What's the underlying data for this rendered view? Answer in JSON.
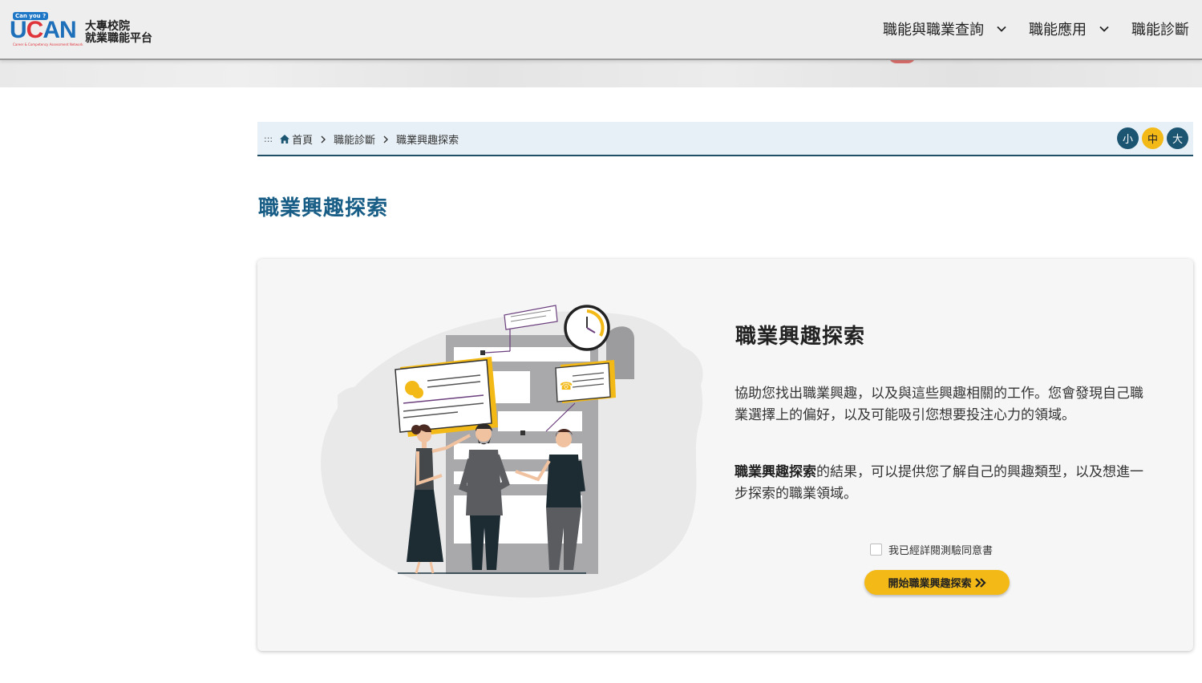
{
  "header": {
    "logo": {
      "badge": "Can you ?",
      "brand_u": "U",
      "brand_c": "C",
      "brand_an": "AN",
      "tagline": "Career & Competency Assessment Network",
      "name_line1": "大專校院",
      "name_line2": "就業職能平台"
    },
    "nav": [
      {
        "label": "職能與職業查詢",
        "has_dropdown": true,
        "icon": "chevron-down-icon"
      },
      {
        "label": "職能應用",
        "has_dropdown": true,
        "icon": "chevron-down-icon"
      },
      {
        "label": "職能診斷",
        "has_dropdown": false
      }
    ]
  },
  "breadcrumb": {
    "accesskey": ":::",
    "items": [
      "首頁",
      "職能診斷",
      "職業興趣探索"
    ],
    "home_icon": "home-icon",
    "separator_icon": "chevron-right-icon"
  },
  "font_size": {
    "small": "小",
    "medium": "中",
    "large": "大",
    "selected": "中"
  },
  "page_title": "職業興趣探索",
  "card": {
    "title": "職業興趣探索",
    "desc1": "協助您找出職業興趣，以及與這些興趣相關的工作。您會發現自己職業選擇上的偏好，以及可能吸引您想要投注心力的領域。",
    "desc2_bold": "職業興趣探索",
    "desc2_rest": "的結果，可以提供您了解自己的興趣類型，以及想進一步探索的職業領域。",
    "agree_label": "我已經詳閱測驗同意書",
    "agree_checked": false,
    "start_button": "開始職業興趣探索",
    "start_icon": "double-chevron-right-icon"
  },
  "colors": {
    "accent_yellow": "#f3b916",
    "brand_blue": "#175d85",
    "dark_teal": "#1c5571",
    "breadcrumb_bg": "#e7f0f6"
  }
}
